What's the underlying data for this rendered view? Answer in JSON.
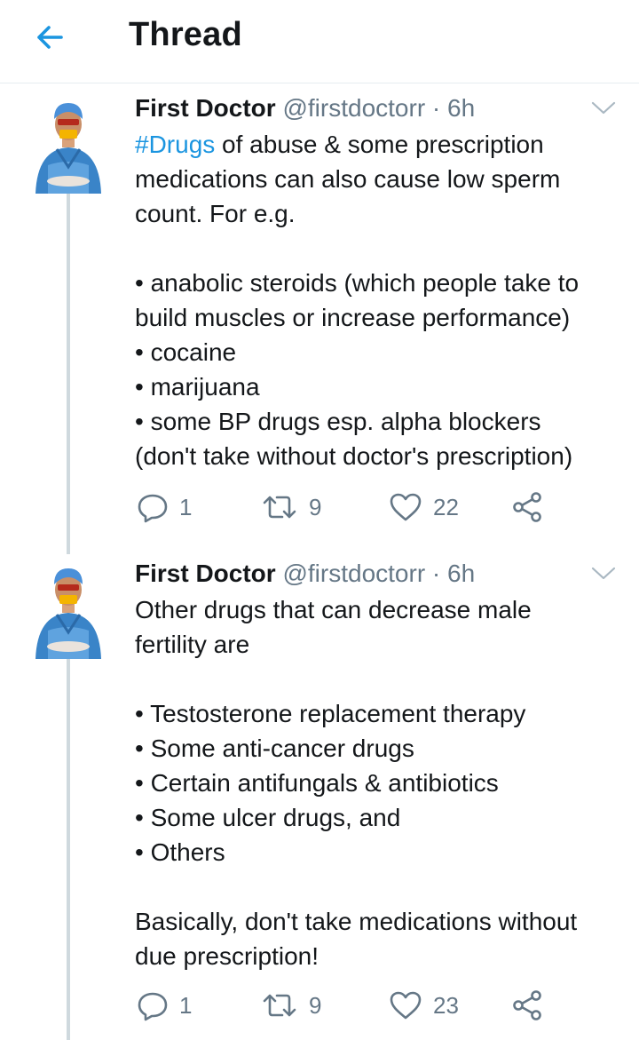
{
  "header": {
    "title": "Thread"
  },
  "colors": {
    "accent": "#1b95e0",
    "secondary": "#657786",
    "text": "#14171a",
    "divider": "#e6ecf0"
  },
  "icons": {
    "back": "arrow-left-icon",
    "caret": "chevron-down-icon",
    "reply": "reply-icon",
    "retweet": "retweet-icon",
    "like": "heart-icon",
    "share": "share-icon"
  },
  "tweets": [
    {
      "author_name": "First Doctor",
      "handle": "@firstdoctorr",
      "separator": "·",
      "time": "6h",
      "hashtag": "#Drugs",
      "lines": [
        " of abuse & some prescription",
        "medications can also cause low sperm",
        "count. For e.g.",
        "",
        "• anabolic steroids (which people take to",
        "build muscles or increase performance)",
        "• cocaine",
        "• marijuana",
        "• some BP drugs esp. alpha blockers",
        "(don't take without doctor's prescription)"
      ],
      "replies": "1",
      "retweets": "9",
      "likes": "22"
    },
    {
      "author_name": "First Doctor",
      "handle": "@firstdoctorr",
      "separator": "·",
      "time": "6h",
      "lines": [
        "Other drugs that can decrease male",
        "fertility are",
        "",
        "• Testosterone replacement therapy",
        "• Some anti-cancer drugs",
        "• Certain antifungals & antibiotics",
        "• Some ulcer drugs, and",
        "• Others",
        "",
        "Basically, don't take medications without",
        "due prescription!"
      ],
      "replies": "1",
      "retweets": "9",
      "likes": "23"
    }
  ]
}
